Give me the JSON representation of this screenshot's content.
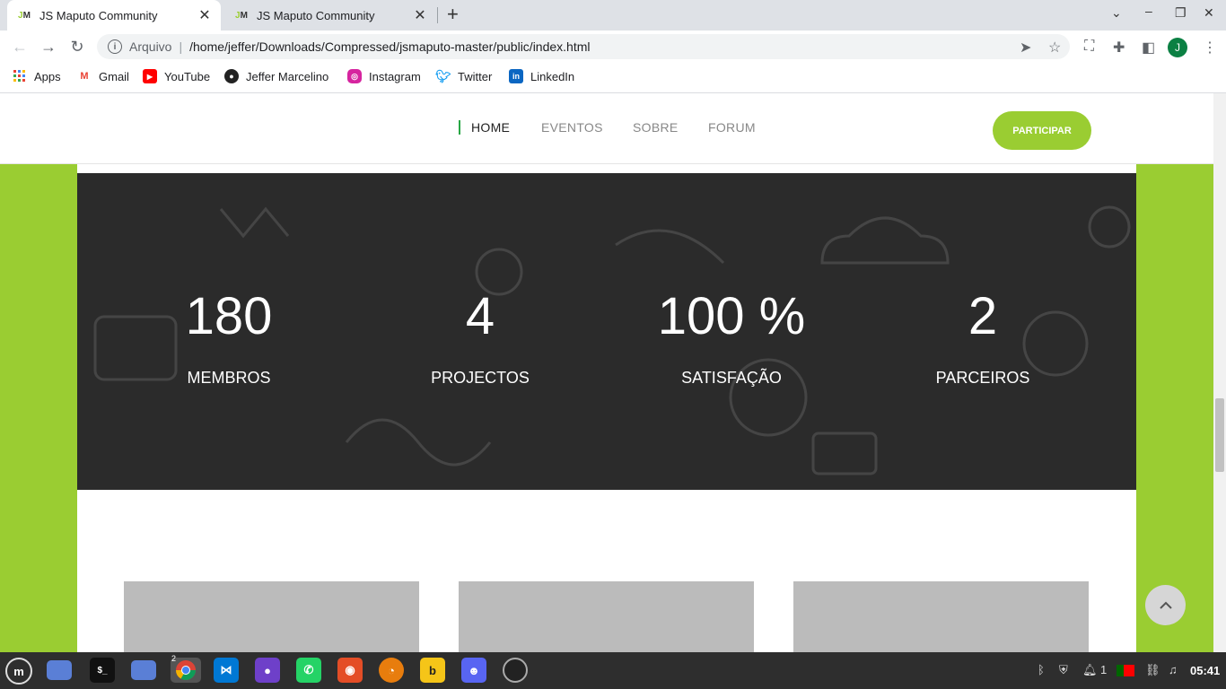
{
  "browser": {
    "tabs": [
      {
        "favicon": "JM",
        "title": "JS Maputo Community",
        "active": true
      },
      {
        "favicon": "JM",
        "title": "JS Maputo Community",
        "active": false
      }
    ],
    "close_glyph": "✕",
    "new_tab_glyph": "+",
    "address": {
      "scheme_label": "Arquivo",
      "separator": "|",
      "url": "/home/jeffer/Downloads/Compressed/jsmaputo-master/public/index.html"
    },
    "profile_initial": "J",
    "bookmarks": [
      {
        "label": "Apps",
        "icon": "apps-grid-icon"
      },
      {
        "label": "Gmail",
        "icon": "gmail-icon"
      },
      {
        "label": "YouTube",
        "icon": "youtube-icon"
      },
      {
        "label": "Jeffer Marcelino",
        "icon": "github-icon"
      },
      {
        "label": "Instagram",
        "icon": "instagram-icon"
      },
      {
        "label": "Twitter",
        "icon": "twitter-icon"
      },
      {
        "label": "LinkedIn",
        "icon": "linkedin-icon"
      }
    ]
  },
  "site": {
    "nav": [
      {
        "label": "HOME",
        "active": true
      },
      {
        "label": "EVENTOS",
        "active": false
      },
      {
        "label": "SOBRE",
        "active": false
      },
      {
        "label": "FORUM",
        "active": false
      }
    ],
    "cta_label": "PARTICIPAR",
    "stats": [
      {
        "value": "180",
        "label": "MEMBROS"
      },
      {
        "value": "4",
        "label": "PROJECTOS"
      },
      {
        "value": "100 %",
        "label": "SATISFAÇÃO"
      },
      {
        "value": "2",
        "label": "PARCEIROS"
      }
    ],
    "accent_color": "#9acd32"
  },
  "taskbar": {
    "apps": [
      "mint-menu-icon",
      "desktop-icon",
      "terminal-icon",
      "files-icon",
      "chrome-icon",
      "vscode-icon",
      "github-desktop-icon",
      "whatsapp-icon",
      "gimp-icon",
      "blender-icon",
      "bitwarden-icon",
      "discord-icon",
      "obs-icon"
    ],
    "chrome_window_count": "2",
    "notification_count": "1",
    "clock": "05:41"
  }
}
